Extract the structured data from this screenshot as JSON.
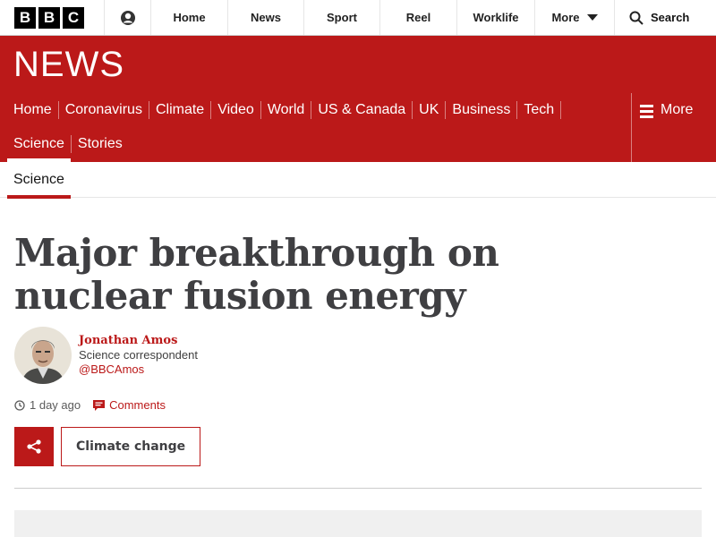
{
  "topbar": {
    "logo_letters": [
      "B",
      "B",
      "C"
    ],
    "items": [
      {
        "label": "Home"
      },
      {
        "label": "News"
      },
      {
        "label": "Sport"
      },
      {
        "label": "Reel"
      },
      {
        "label": "Worklife"
      }
    ],
    "more_label": "More",
    "search_label": "Search"
  },
  "banner": {
    "title": "NEWS"
  },
  "section_nav": {
    "row1": [
      "Home",
      "Coronavirus",
      "Climate",
      "Video",
      "World",
      "US & Canada",
      "UK",
      "Business",
      "Tech"
    ],
    "row2": [
      "Science",
      "Stories"
    ],
    "more_label": "More"
  },
  "subnav": {
    "active": "Science"
  },
  "article": {
    "headline": "Major breakthrough on nuclear fusion energy",
    "author": {
      "name": "Jonathan Amos",
      "role": "Science correspondent",
      "handle": "@BBCAmos"
    },
    "time": "1 day ago",
    "comments_label": "Comments",
    "tag": "Climate change"
  },
  "colors": {
    "brand_red": "#bb1919",
    "headline": "#3f3f42"
  }
}
